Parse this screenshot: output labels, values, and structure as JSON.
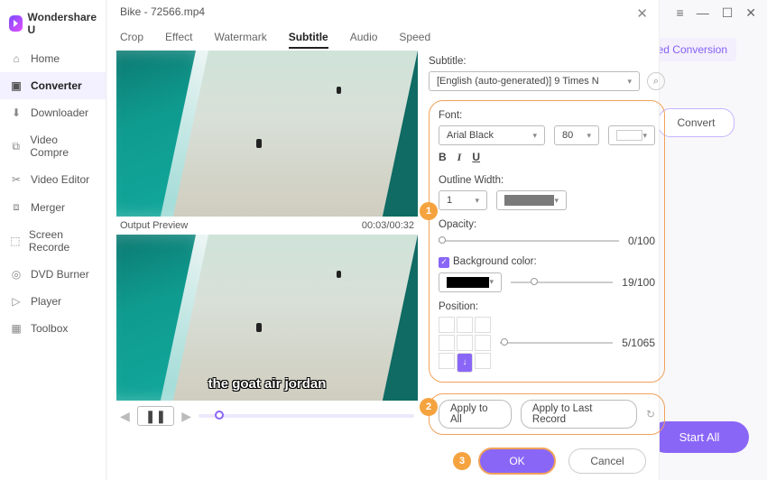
{
  "brand": "Wondershare U",
  "nav": [
    "Home",
    "Converter",
    "Downloader",
    "Video Compre",
    "Video Editor",
    "Merger",
    "Screen Recorde",
    "DVD Burner",
    "Player",
    "Toolbox"
  ],
  "nav_active": 1,
  "topbar": {
    "speed_label": "Speed Conversion",
    "convert": "Convert",
    "start_all": "Start All"
  },
  "modal": {
    "title": "Bike - 72566.mp4",
    "tabs": [
      "Crop",
      "Effect",
      "Watermark",
      "Subtitle",
      "Audio",
      "Speed"
    ],
    "tab_active": 3,
    "preview": {
      "label": "Output Preview",
      "time": "00:03/00:32",
      "caption": "the goat air jordan"
    },
    "subtitle": {
      "label": "Subtitle:",
      "value": "[English (auto-generated)] 9 Times N"
    },
    "font": {
      "label": "Font:",
      "family": "Arial Black",
      "size": "80"
    },
    "outline": {
      "label": "Outline Width:",
      "value": "1"
    },
    "opacity": {
      "label": "Opacity:",
      "display": "0/100",
      "pos": 0
    },
    "bgcolor": {
      "label": "Background color:",
      "display": "19/100",
      "pos": 19
    },
    "position": {
      "label": "Position:",
      "display": "5/1065",
      "pos": 1
    },
    "apply": {
      "all": "Apply to All",
      "last": "Apply to Last Record"
    },
    "buttons": {
      "ok": "OK",
      "cancel": "Cancel"
    }
  },
  "badges": {
    "b1": "1",
    "b2": "2",
    "b3": "3"
  }
}
